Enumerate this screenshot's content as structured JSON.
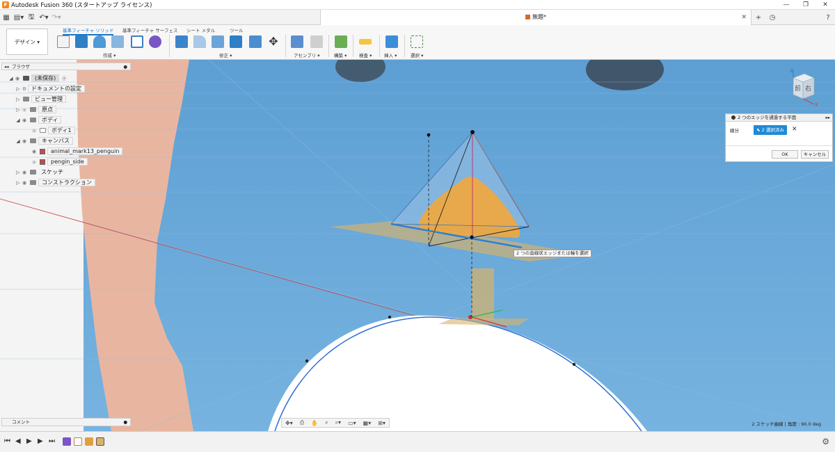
{
  "app": {
    "title": "Autodesk Fusion 360 (スタートアップ ライセンス)",
    "document_title": "無題*"
  },
  "ribbon": {
    "workspace_button": "デザイン ▾",
    "tabs": [
      {
        "label": "基準フィーチャ ソリッド",
        "active": true
      },
      {
        "label": "基準フィーチャ サーフェス",
        "active": false
      },
      {
        "label": "シート メタル",
        "active": false
      },
      {
        "label": "ツール",
        "active": false
      }
    ],
    "groups": {
      "create": "作成 ▾",
      "modify": "修正 ▾",
      "assemble": "アセンブリ ▾",
      "construct": "構築 ▾",
      "inspect": "検査 ▾",
      "insert": "挿入 ▾",
      "select": "選択 ▾"
    }
  },
  "browser": {
    "header": "ブラウザ",
    "root": "(未保存)",
    "items": [
      {
        "label": "ドキュメントの設定"
      },
      {
        "label": "ビュー管理"
      },
      {
        "label": "原点"
      },
      {
        "label": "ボディ"
      },
      {
        "label": "ボディ1"
      },
      {
        "label": "キャンバス"
      },
      {
        "label": "animal_mark13_penguin"
      },
      {
        "label": "pengin_side"
      },
      {
        "label": "スケッチ"
      },
      {
        "label": "コンストラクション"
      }
    ]
  },
  "dialog": {
    "title": "2 つのエッジを通過する平面",
    "field_label": "線分",
    "selection_button": "2 選択済み",
    "ok": "OK",
    "cancel": "キャンセル"
  },
  "tooltip": "2 つの直線状エッジまたは軸を選択",
  "viewcube": {
    "front": "前",
    "right": "右",
    "axis_z": "Z",
    "axis_x": "X"
  },
  "comment": {
    "label": "コメント"
  },
  "status": "2 スケッチ曲線 | 角度 : 90.0 deg",
  "colors": {
    "accent": "#1f8ad6",
    "sky": "#6aa9d8",
    "peach": "#e8b6a0",
    "plane": "#d9b26a"
  }
}
